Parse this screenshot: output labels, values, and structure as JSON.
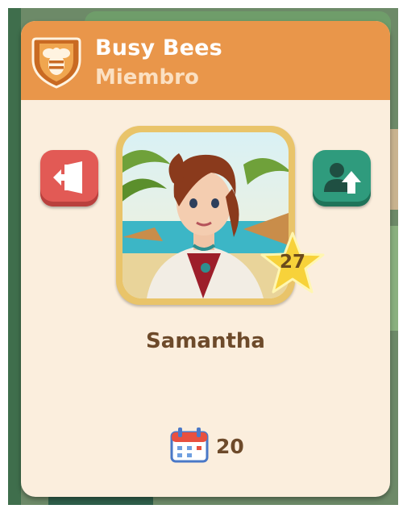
{
  "team": {
    "name": "Busy Bees",
    "role": "Miembro",
    "badge_icon": "bee-shield-icon"
  },
  "player": {
    "name": "Samantha",
    "level": "27"
  },
  "stats": {
    "days": "20",
    "days_icon": "calendar-icon"
  },
  "actions": {
    "leave_icon": "exit-door-icon",
    "promote_icon": "user-promote-icon"
  },
  "colors": {
    "header": "#e9964a",
    "card": "#fbeedd",
    "leave_button": "#e25a55",
    "promote_button": "#2f9b7d",
    "frame": "#e9c46a",
    "text_brown": "#6d4a2a"
  }
}
